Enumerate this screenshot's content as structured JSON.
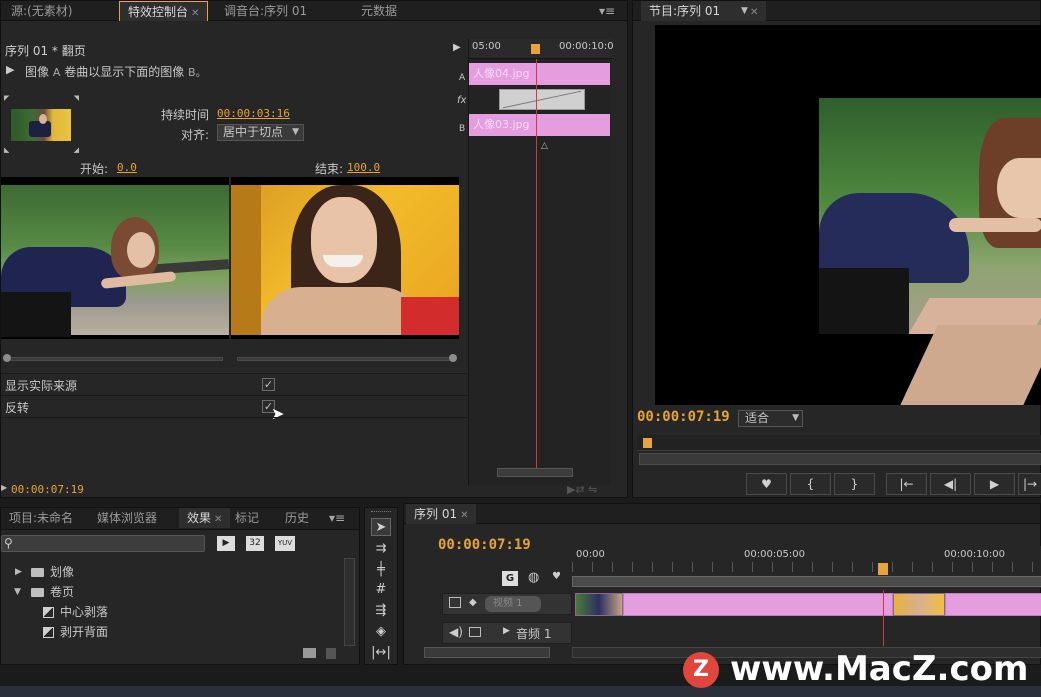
{
  "effect_controls": {
    "tabs": [
      "源:(无素材)",
      "特效控制台",
      "调音台:序列 01",
      "元数据"
    ],
    "sequence_title": "序列 01 * 翻页",
    "description_prefix": "图像",
    "description_a": "A",
    "description_main": "卷曲以显示下面的图像",
    "description_b": "B。",
    "duration_label": "持续时间",
    "duration_value": "00:00:03:16",
    "align_label": "对齐:",
    "align_value": "居中于切点",
    "start_label": "开始:",
    "start_value": "0.0",
    "end_label": "结束:",
    "end_value": "100.0",
    "show_actual_sources_label": "显示实际来源",
    "reverse_label": "反转",
    "bottom_timecode": "00:00:07:19",
    "mini_timeline": {
      "ruler_left": "05:00",
      "ruler_right": "00:00:10:0",
      "track_a": "A",
      "track_b": "B",
      "fx": "fx",
      "clip_a_label": "人像04.jpg",
      "clip_b_label": "人像03.jpg"
    }
  },
  "program": {
    "tab_label": "节目:序列 01",
    "timecode": "00:00:07:19",
    "fit_value": "适合",
    "transport_buttons": [
      "♥",
      "{",
      "}",
      "|←",
      "◀|",
      "▶",
      "|→"
    ]
  },
  "project": {
    "tabs": [
      "项目:未命名",
      "媒体浏览器",
      "效果",
      "标记",
      "历史"
    ],
    "badge_32": "32",
    "badge_yuv": "YUV",
    "tree": [
      {
        "label": "划像",
        "type": "folder"
      },
      {
        "label": "卷页",
        "type": "folder"
      },
      {
        "label": "中心剥落",
        "type": "effect"
      },
      {
        "label": "剥开背面",
        "type": "effect"
      }
    ]
  },
  "timeline": {
    "tab_label": "序列 01",
    "timecode": "00:00:07:19",
    "ruler": [
      "00:00",
      "00:00:05:00",
      "00:00:10:00"
    ],
    "video_track": "视频 1",
    "audio_track": "音频 1"
  },
  "watermark": "www.MacZ.com",
  "watermark_logo": "Z"
}
